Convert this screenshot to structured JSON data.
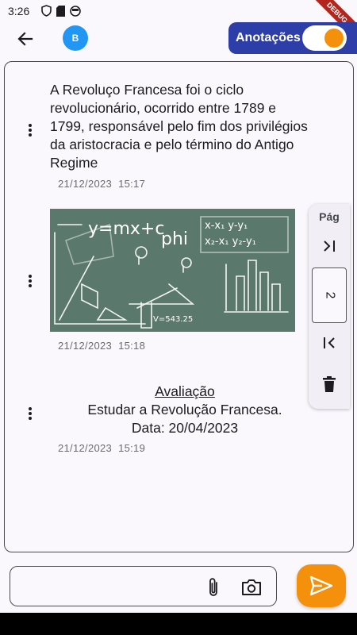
{
  "status": {
    "time": "3:26"
  },
  "debug": "DEBUG",
  "appbar": {
    "avatar_letter": "B",
    "toggle_label": "Anotações",
    "toggle_on": true
  },
  "notes": [
    {
      "type": "text",
      "text": "A Revoluço Francesa foi o ciclo revolucionário, ocorrido entre 1789 e 1799, responsável pelo fim dos privilégios da aristocracia e pelo término  do Antigo Regime",
      "date": "21/12/2023",
      "time": "15:17"
    },
    {
      "type": "image",
      "image_desc": "chalkboard-math-drawing",
      "date": "21/12/2023",
      "time": "15:18"
    },
    {
      "type": "evaluation",
      "title": "Avaliação",
      "line1": "Estudar a Revolução  Francesa.",
      "line2": "Data: 20/04/2023",
      "date": "21/12/2023",
      "time": "15:19"
    }
  ],
  "pager": {
    "label": "Pág",
    "page": "2"
  },
  "composer": {
    "placeholder": "",
    "value": ""
  },
  "colors": {
    "accent": "#f4900c",
    "toggle_bg": "#2d3ea8",
    "avatar": "#2196f3"
  }
}
